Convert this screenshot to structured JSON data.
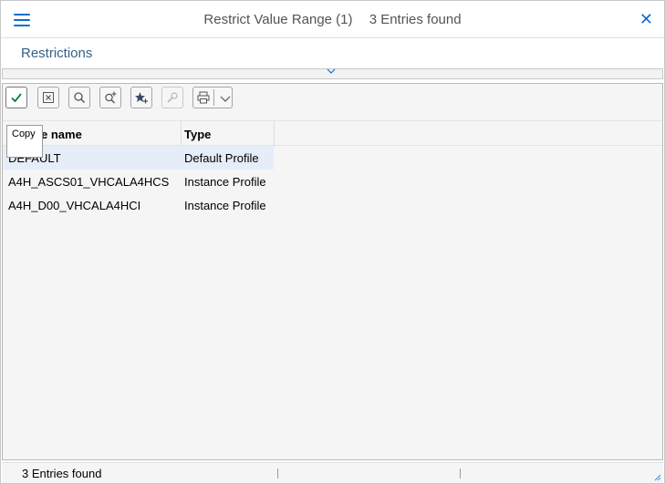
{
  "window": {
    "title": "Restrict Value Range (1)",
    "entries_found": "3 Entries found",
    "close_glyph": "✕"
  },
  "tabs": {
    "restrictions_label": "Restrictions"
  },
  "toolbar": {
    "buttons": [
      {
        "name": "copy-button",
        "icon": "check-icon"
      },
      {
        "name": "cancel-button",
        "icon": "close-box-icon"
      },
      {
        "name": "search-button",
        "icon": "search-icon"
      },
      {
        "name": "search-more-button",
        "icon": "search-plus-icon"
      },
      {
        "name": "favorites-button",
        "icon": "star-plus-icon"
      },
      {
        "name": "help-button",
        "icon": "wrench-icon"
      },
      {
        "name": "print-button",
        "icon": "printer-icon"
      }
    ],
    "tooltip": "Copy"
  },
  "grid": {
    "columns": [
      "Profile name",
      "Type"
    ],
    "visible_header_fragment": "e name",
    "rows": [
      {
        "name": "DEFAULT",
        "type": "Default Profile"
      },
      {
        "name": "A4H_ASCS01_VHCALA4HCS",
        "type": "Instance Profile"
      },
      {
        "name": "A4H_D00_VHCALA4HCI",
        "type": "Instance Profile"
      }
    ]
  },
  "status": {
    "text": "3 Entries found"
  },
  "colors": {
    "accent": "#0a6ed1",
    "tab_text": "#346187",
    "check_green": "#107e3e",
    "selected_row": "#e5eef8"
  }
}
